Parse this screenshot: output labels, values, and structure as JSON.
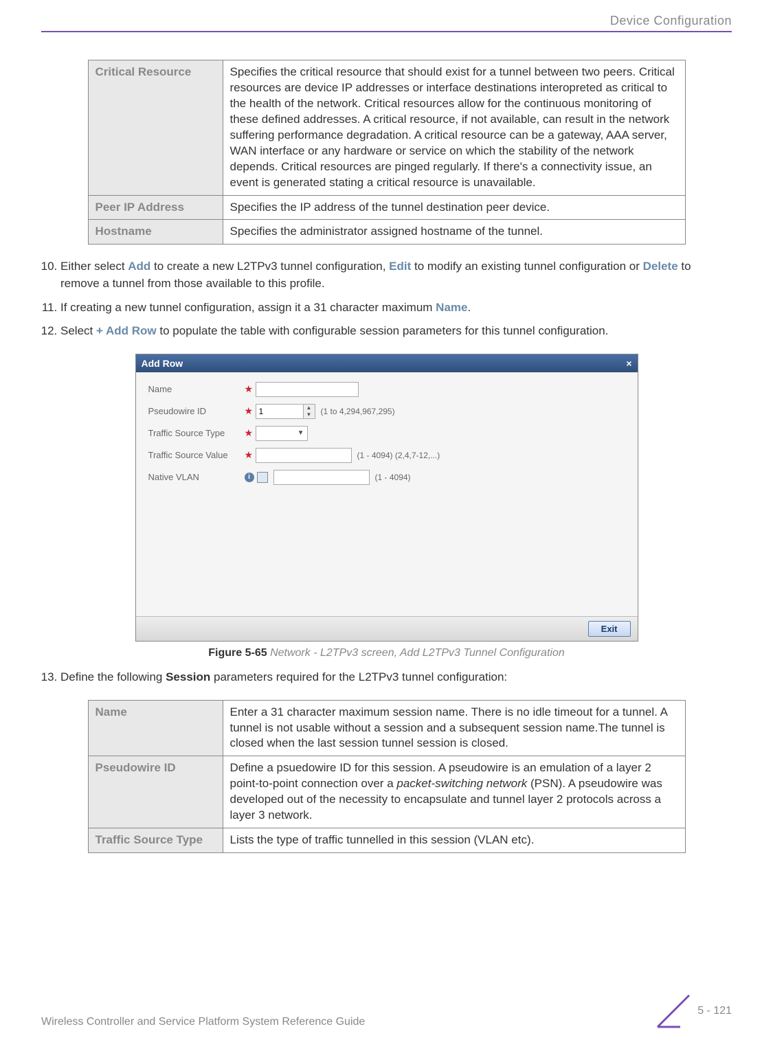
{
  "header": {
    "section": "Device Configuration"
  },
  "table1": {
    "rows": [
      {
        "label": "Critical Resource",
        "desc": "Specifies the critical resource that should exist for a tunnel between two peers. Critical resources are device IP addresses or interface destinations interopreted as critical to the health of the network. Critical resources allow for the continuous monitoring of these defined addresses. A critical resource, if not available, can result in the network suffering performance degradation. A critical resource can be a gateway, AAA server, WAN interface or any hardware or service on which the stability of the network depends. Critical resources are pinged regularly. If there's a connectivity issue, an event is generated stating a critical resource is unavailable."
      },
      {
        "label": "Peer IP Address",
        "desc": "Specifies the IP address of the tunnel destination peer device."
      },
      {
        "label": "Hostname",
        "desc": "Specifies the administrator assigned hostname of the tunnel."
      }
    ]
  },
  "step10": {
    "num": "10",
    "pre": "Either select ",
    "add": "Add",
    "mid1": " to create a new L2TPv3 tunnel configuration, ",
    "edit": "Edit",
    "mid2": " to modify an existing tunnel configuration or ",
    "delete": "Delete",
    "post": " to remove a tunnel from those available to this profile."
  },
  "step11": {
    "num": "11",
    "pre": "If creating a new tunnel configuration, assign it a 31 character maximum ",
    "name": "Name",
    "post": "."
  },
  "step12": {
    "num": "12",
    "pre": "Select ",
    "addrow": "+ Add Row",
    "post": " to populate the table with configurable session parameters for this tunnel configuration."
  },
  "dialog": {
    "title": "Add Row",
    "close": "×",
    "fields": {
      "name_label": "Name",
      "pseudo_label": "Pseudowire ID",
      "pseudo_value": "1",
      "pseudo_hint": "(1 to 4,294,967,295)",
      "tstype_label": "Traffic Source Type",
      "tsval_label": "Traffic Source Value",
      "tsval_hint": "(1 - 4094)  (2,4,7-12,...)",
      "native_label": "Native VLAN",
      "native_hint": "(1 - 4094)",
      "info_glyph": "i"
    },
    "exit": "Exit"
  },
  "figure": {
    "num": "Figure 5-65",
    "title": "Network - L2TPv3 screen, Add L2TPv3 Tunnel Configuration"
  },
  "step13": {
    "num": "13",
    "pre": "Define the following ",
    "session": "Session",
    "post": " parameters required for the L2TPv3 tunnel configuration:"
  },
  "table2": {
    "rows": [
      {
        "label": "Name",
        "desc_pre": "Enter a 31 character maximum session name. There is no idle timeout for a tunnel. A tunnel is not usable without a session and a subsequent session name.The tunnel is closed when the last session tunnel session is closed.",
        "italic": "",
        "desc_post": ""
      },
      {
        "label": "Pseudowire ID",
        "desc_pre": "Define a psuedowire ID for this session. A pseudowire is an emulation of a layer 2 point-to-point connection over a ",
        "italic": "packet-switching network",
        "desc_post": " (PSN). A pseudowire was developed out of the necessity to encapsulate and tunnel layer 2 protocols across a layer 3 network."
      },
      {
        "label": "Traffic Source Type",
        "desc_pre": "Lists the type of traffic tunnelled in this session (VLAN etc).",
        "italic": "",
        "desc_post": ""
      }
    ]
  },
  "footer": {
    "guide": "Wireless Controller and Service Platform System Reference Guide",
    "page": "5 - 121"
  }
}
